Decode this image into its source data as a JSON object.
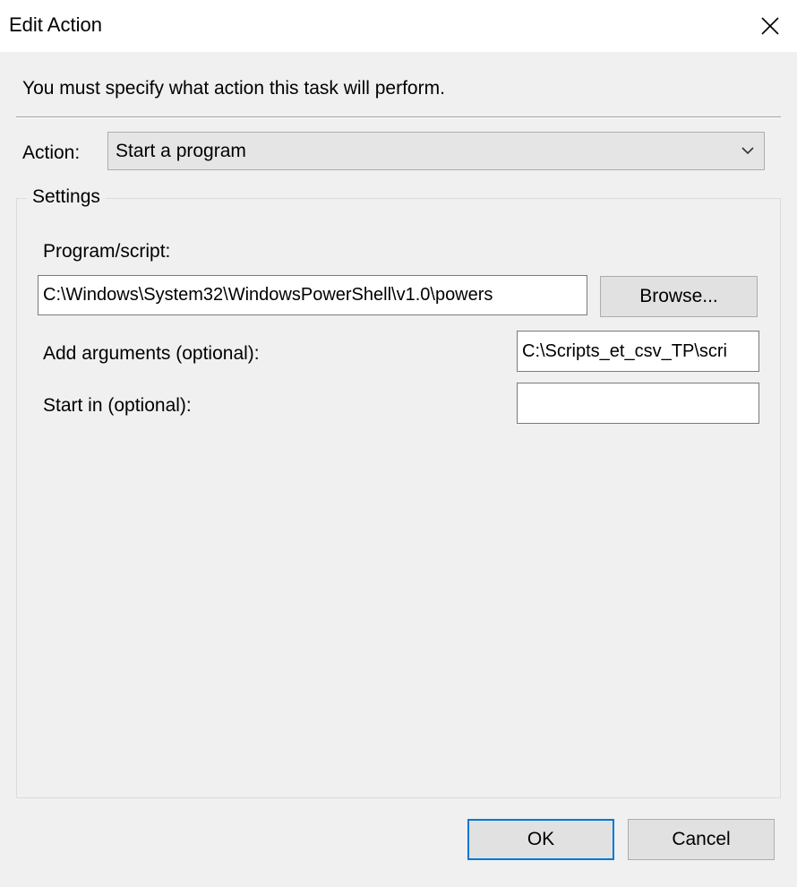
{
  "window": {
    "title": "Edit Action",
    "close_icon": "close-icon"
  },
  "instruction": "You must specify what action this task will perform.",
  "action": {
    "label": "Action:",
    "selected": "Start a program",
    "chevron_icon": "chevron-down-icon"
  },
  "settings": {
    "legend": "Settings",
    "program_label": "Program/script:",
    "program_value": "C:\\Windows\\System32\\WindowsPowerShell\\v1.0\\powers",
    "browse_label": "Browse...",
    "arguments_label": "Add arguments (optional):",
    "arguments_value": "C:\\Scripts_et_csv_TP\\scri",
    "startin_label": "Start in (optional):",
    "startin_value": ""
  },
  "buttons": {
    "ok_label": "OK",
    "cancel_label": "Cancel"
  }
}
